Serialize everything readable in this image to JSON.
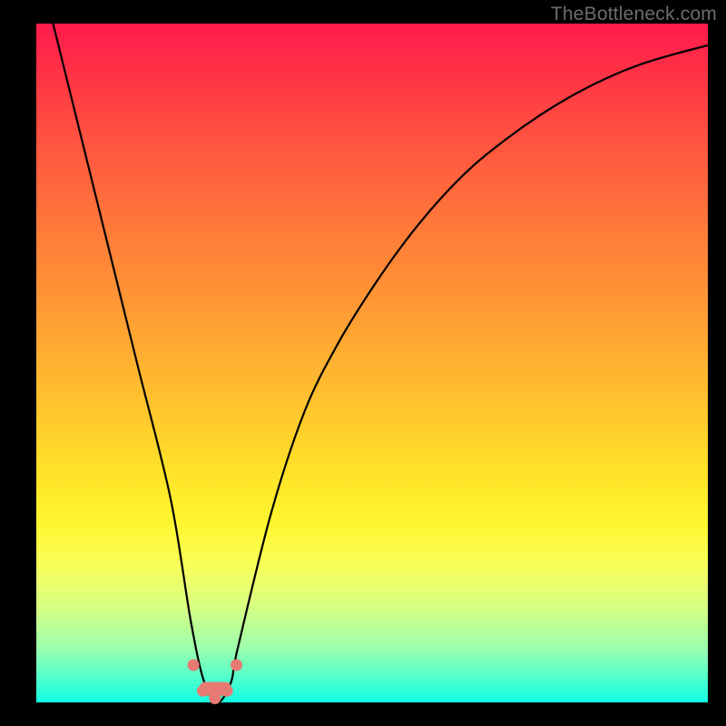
{
  "watermark": "TheBottleneck.com",
  "colors": {
    "frame": "#000000",
    "gradient_top": "#ff1a4c",
    "gradient_bottom": "#12ffe1",
    "curve": "#000000",
    "marker": "#e77a72"
  },
  "chart_data": {
    "type": "line",
    "title": "",
    "xlabel": "",
    "ylabel": "",
    "xlim": [
      0,
      100
    ],
    "ylim": [
      0,
      100
    ],
    "grid": false,
    "legend": false,
    "series": [
      {
        "name": "bottleneck-curve",
        "x": [
          0,
          5,
          10,
          15,
          20,
          23,
          25,
          27,
          29,
          30,
          35,
          40,
          45,
          50,
          55,
          60,
          65,
          70,
          75,
          80,
          85,
          90,
          95,
          100
        ],
        "values": [
          110,
          90,
          70,
          50,
          30,
          12,
          3,
          0,
          3,
          8,
          28,
          43,
          53,
          61,
          68,
          74,
          79,
          83,
          86.5,
          89.5,
          92,
          94,
          95.5,
          96.8
        ]
      }
    ],
    "markers": [
      {
        "x": 23.4,
        "y": 5.5
      },
      {
        "x": 24.8,
        "y": 1.7
      },
      {
        "x": 26.6,
        "y": 0.6
      },
      {
        "x": 28.4,
        "y": 1.7
      },
      {
        "x": 29.8,
        "y": 5.5
      }
    ],
    "marker_bar": {
      "x_start": 24.3,
      "x_end": 29.0,
      "y": 1.0,
      "height": 2.0
    }
  }
}
